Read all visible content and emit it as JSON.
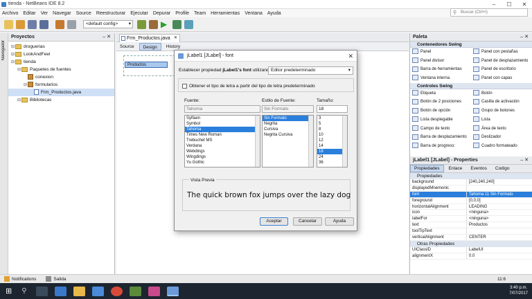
{
  "window": {
    "title": "tienda - NetBeans IDE 8.2",
    "search_placeholder": "Buscar (Ctrl+I)"
  },
  "menu": [
    "Archivo",
    "Editar",
    "Ver",
    "Navegar",
    "Source",
    "Reestructurar",
    "Ejecutar",
    "Depurar",
    "Profile",
    "Team",
    "Herramientas",
    "Ventana",
    "Ayuda"
  ],
  "toolbar": {
    "config": "<default config>"
  },
  "navigator_label": "Navegador",
  "projects": {
    "title": "Proyectos",
    "items": [
      {
        "label": "droguerias",
        "indent": 0,
        "type": "project"
      },
      {
        "label": "LookAndFeel",
        "indent": 0,
        "type": "project"
      },
      {
        "label": "tienda",
        "indent": 0,
        "type": "project"
      },
      {
        "label": "Paquetes de fuentes",
        "indent": 1,
        "type": "folder"
      },
      {
        "label": "conexion",
        "indent": 2,
        "type": "package"
      },
      {
        "label": "formularios",
        "indent": 2,
        "type": "package"
      },
      {
        "label": "Frm_Productos.java",
        "indent": 3,
        "type": "file"
      },
      {
        "label": "Bibliotecas",
        "indent": 1,
        "type": "folder"
      }
    ]
  },
  "editor": {
    "tab": "Frm_Productos.java",
    "subtabs": [
      "Source",
      "Design",
      "History"
    ],
    "label_text": "Productos"
  },
  "dialog": {
    "title": "jLabel1 [JLabel] - font",
    "set_prop_prefix": "Establecer propiedad ",
    "set_prop_bold": "jLabel1's font",
    "set_prop_suffix": " utilizando:",
    "editor_select": "Editor predeterminado",
    "checkbox": "Obtener el tipo de letra a partir del tipo de letra predeterminado",
    "font_label": "Fuente:",
    "style_label": "Estilo de Fuente:",
    "size_label": "Tamaño:",
    "font_value": "Tahoma",
    "style_value": "Sin Formato",
    "size_value": "18",
    "fonts": [
      "Sylfaen",
      "Symbol",
      "Tahoma",
      "Times New Roman",
      "Trebuchet MS",
      "Verdana",
      "Webdings",
      "Wingdings",
      "Yu Gothic"
    ],
    "fonts_selected": 2,
    "styles": [
      "Sin Formato",
      "Negrita",
      "Cursiva",
      "Negrita Cursiva"
    ],
    "styles_selected": 0,
    "sizes": [
      "3",
      "5",
      "8",
      "10",
      "12",
      "14",
      "18",
      "24",
      "36"
    ],
    "sizes_selected": 6,
    "preview_label": "Vista Previa",
    "preview_text": "The quick brown fox jumps over the lazy dog",
    "ok": "Aceptar",
    "cancel": "Cancelar",
    "help": "Ayuda"
  },
  "palette": {
    "title": "Paleta",
    "categories": [
      {
        "name": "Contenedores Swing",
        "items": [
          "Panel",
          "Panel con pestañas",
          "Panel divisor",
          "Panel de desplazamiento",
          "Barra de herramientas",
          "Panel de escritorio",
          "Ventana interna",
          "Panel con capas"
        ]
      },
      {
        "name": "Controles Swing",
        "items": [
          "Etiqueta",
          "Botón",
          "Botón de 2 posiciones",
          "Casilla de activación",
          "Botón de opción",
          "Grupo de botones",
          "Lista desplegable",
          "Lista",
          "Campo de texto",
          "Área de texto",
          "Barra de desplazamiento",
          "Deslizador",
          "Barra de progreso:",
          "Cuadro formateado"
        ]
      }
    ]
  },
  "properties": {
    "title": "jLabel1 [JLabel] - Properties",
    "tabs": [
      "Propiedades",
      "Enlace",
      "Eventos",
      "Codigo"
    ],
    "cat1": "Propiedades",
    "rows": [
      {
        "k": "background",
        "v": "[240,240,240]"
      },
      {
        "k": "displayedMnemonic",
        "v": ""
      },
      {
        "k": "font",
        "v": "Tahoma 11 Sin Formato"
      },
      {
        "k": "foreground",
        "v": "[0,0,0]"
      },
      {
        "k": "horizontalAlignment",
        "v": "LEADING"
      },
      {
        "k": "icon",
        "v": "<ninguna>"
      },
      {
        "k": "labelFor",
        "v": "<ninguna>"
      },
      {
        "k": "text",
        "v": "Productos"
      },
      {
        "k": "toolTipText",
        "v": ""
      },
      {
        "k": "verticalAlignment",
        "v": "CENTER"
      }
    ],
    "cat2": "Otras Propiedades",
    "rows2": [
      {
        "k": "UIClassID",
        "v": "LabelUI"
      },
      {
        "k": "alignmentX",
        "v": "0.0"
      }
    ]
  },
  "statusbar": {
    "notifications": "Notifications",
    "output": "Salida",
    "position": "11:6"
  },
  "taskbar": {
    "time": "3:40 p.m.",
    "date": "7/07/2017"
  },
  "colors": {
    "selection": "#2a7fdc",
    "dark_taskbar": "#1c2530"
  }
}
